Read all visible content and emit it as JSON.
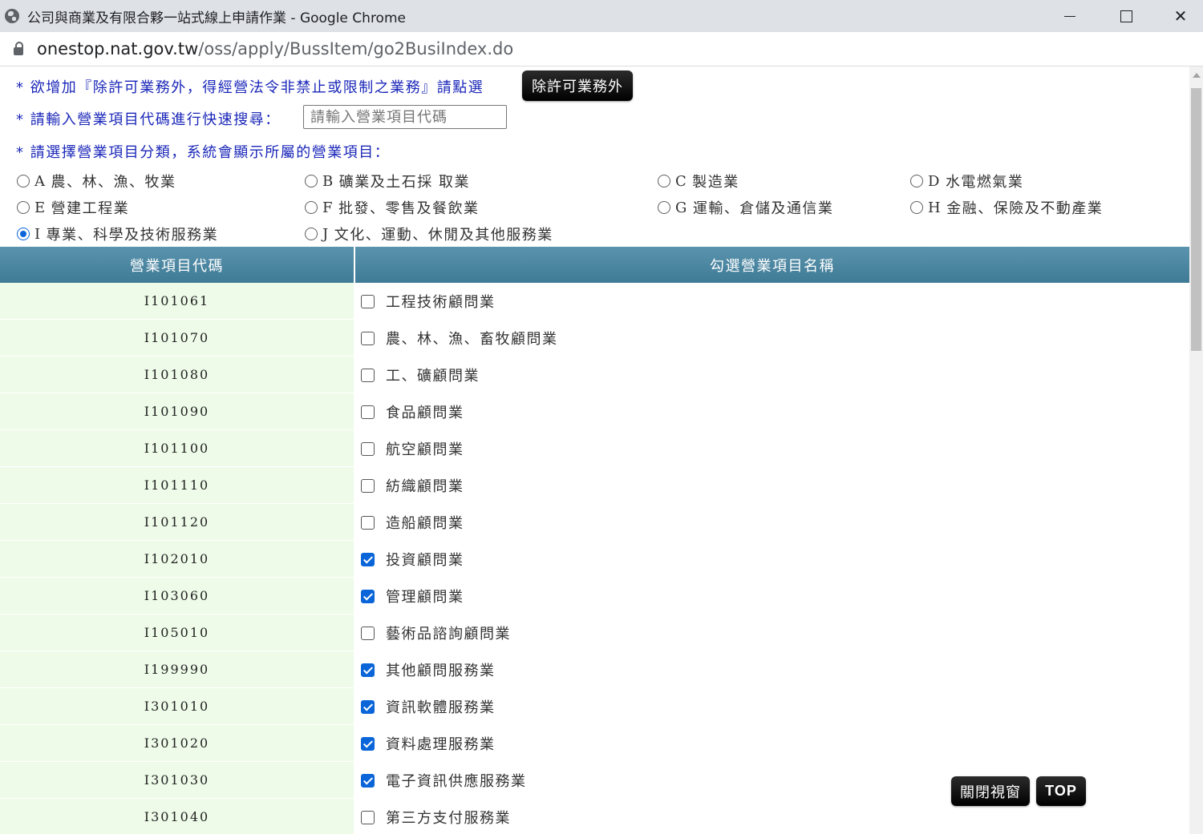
{
  "window": {
    "title": "公司與商業及有限合夥一站式線上申請作業 - Google Chrome",
    "minimize_label": "",
    "close_label": "✕"
  },
  "address": {
    "host": "onestop.nat.gov.tw",
    "path": "/oss/apply/BussItem/go2BusiIndex.do"
  },
  "instructions": {
    "line1": "* 欲增加『除許可業務外，得經營法令非禁止或限制之業務』請點選",
    "line1_button": "除許可業務外",
    "line2": "* 請輸入營業項目代碼進行快速搜尋：",
    "search_placeholder": "請輸入營業項目代碼",
    "line3": "* 請選擇營業項目分類，系統會顯示所屬的營業項目："
  },
  "categories": [
    {
      "letter": "A",
      "label": "農、林、漁、牧業",
      "selected": false
    },
    {
      "letter": "B",
      "label": "礦業及土石採 取業",
      "selected": false
    },
    {
      "letter": "C",
      "label": "製造業",
      "selected": false
    },
    {
      "letter": "D",
      "label": "水電燃氣業",
      "selected": false
    },
    {
      "letter": "E",
      "label": "營建工程業",
      "selected": false
    },
    {
      "letter": "F",
      "label": "批發、零售及餐飲業",
      "selected": false
    },
    {
      "letter": "G",
      "label": "運輸、倉儲及通信業",
      "selected": false
    },
    {
      "letter": "H",
      "label": "金融、保險及不動產業",
      "selected": false
    },
    {
      "letter": "I",
      "label": "專業、科學及技術服務業",
      "selected": true
    },
    {
      "letter": "J",
      "label": "文化、運動、休閒及其他服務業",
      "selected": false
    }
  ],
  "table": {
    "col_code": "營業項目代碼",
    "col_name": "勾選營業項目名稱",
    "rows": [
      {
        "code": "I101061",
        "name": "工程技術顧問業",
        "checked": false
      },
      {
        "code": "I101070",
        "name": "農、林、漁、畜牧顧問業",
        "checked": false
      },
      {
        "code": "I101080",
        "name": "工、礦顧問業",
        "checked": false
      },
      {
        "code": "I101090",
        "name": "食品顧問業",
        "checked": false
      },
      {
        "code": "I101100",
        "name": "航空顧問業",
        "checked": false
      },
      {
        "code": "I101110",
        "name": "紡織顧問業",
        "checked": false
      },
      {
        "code": "I101120",
        "name": "造船顧問業",
        "checked": false
      },
      {
        "code": "I102010",
        "name": "投資顧問業",
        "checked": true
      },
      {
        "code": "I103060",
        "name": "管理顧問業",
        "checked": true
      },
      {
        "code": "I105010",
        "name": "藝術品諮詢顧問業",
        "checked": false
      },
      {
        "code": "I199990",
        "name": "其他顧問服務業",
        "checked": true
      },
      {
        "code": "I301010",
        "name": "資訊軟體服務業",
        "checked": true
      },
      {
        "code": "I301020",
        "name": "資料處理服務業",
        "checked": true
      },
      {
        "code": "I301030",
        "name": "電子資訊供應服務業",
        "checked": true
      },
      {
        "code": "I301040",
        "name": "第三方支付服務業",
        "checked": false
      }
    ]
  },
  "floating": {
    "close_window": "關閉視窗",
    "top": "TOP"
  }
}
